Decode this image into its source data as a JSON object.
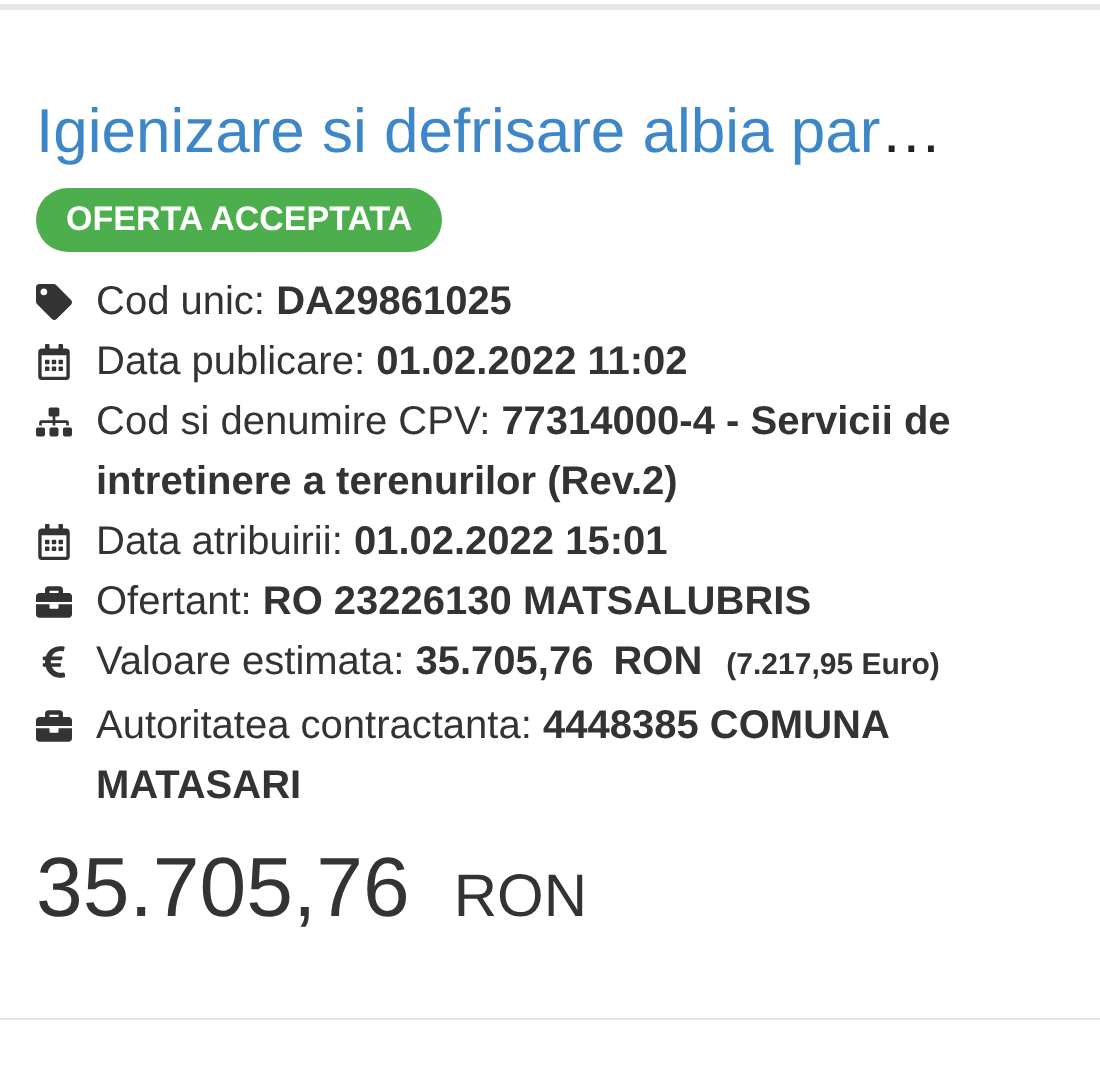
{
  "title": "Igienizare si defrisare albia par…",
  "status": {
    "label": "OFERTA ACCEPTATA",
    "kind": "accepted"
  },
  "details": [
    {
      "kind": "tag",
      "label": "Cod unic:",
      "value": "DA29861025"
    },
    {
      "kind": "calendar",
      "label": "Data publicare:",
      "value": "01.02.2022 11:02"
    },
    {
      "kind": "sitemap",
      "label": "Cod si denumire CPV:",
      "value": "77314000-4 - Servicii de intretinere a terenurilor",
      "note": "(Rev.2)"
    },
    {
      "kind": "calendar",
      "label": "Data atribuirii:",
      "value": "01.02.2022 15:01"
    },
    {
      "kind": "briefcase",
      "label": "Ofertant:",
      "value": "RO 23226130 MATSALUBRIS"
    },
    {
      "kind": "euro",
      "label": "Valoare estimata:",
      "value": "35.705,76",
      "currency": "RON",
      "note": "(7.217,95 Euro)"
    },
    {
      "kind": "briefcase",
      "label": "Autoritatea contractanta:",
      "value": "4448385 COMUNA MATASARI"
    }
  ],
  "price": {
    "amount": "35.705,76",
    "currency": "RON"
  }
}
